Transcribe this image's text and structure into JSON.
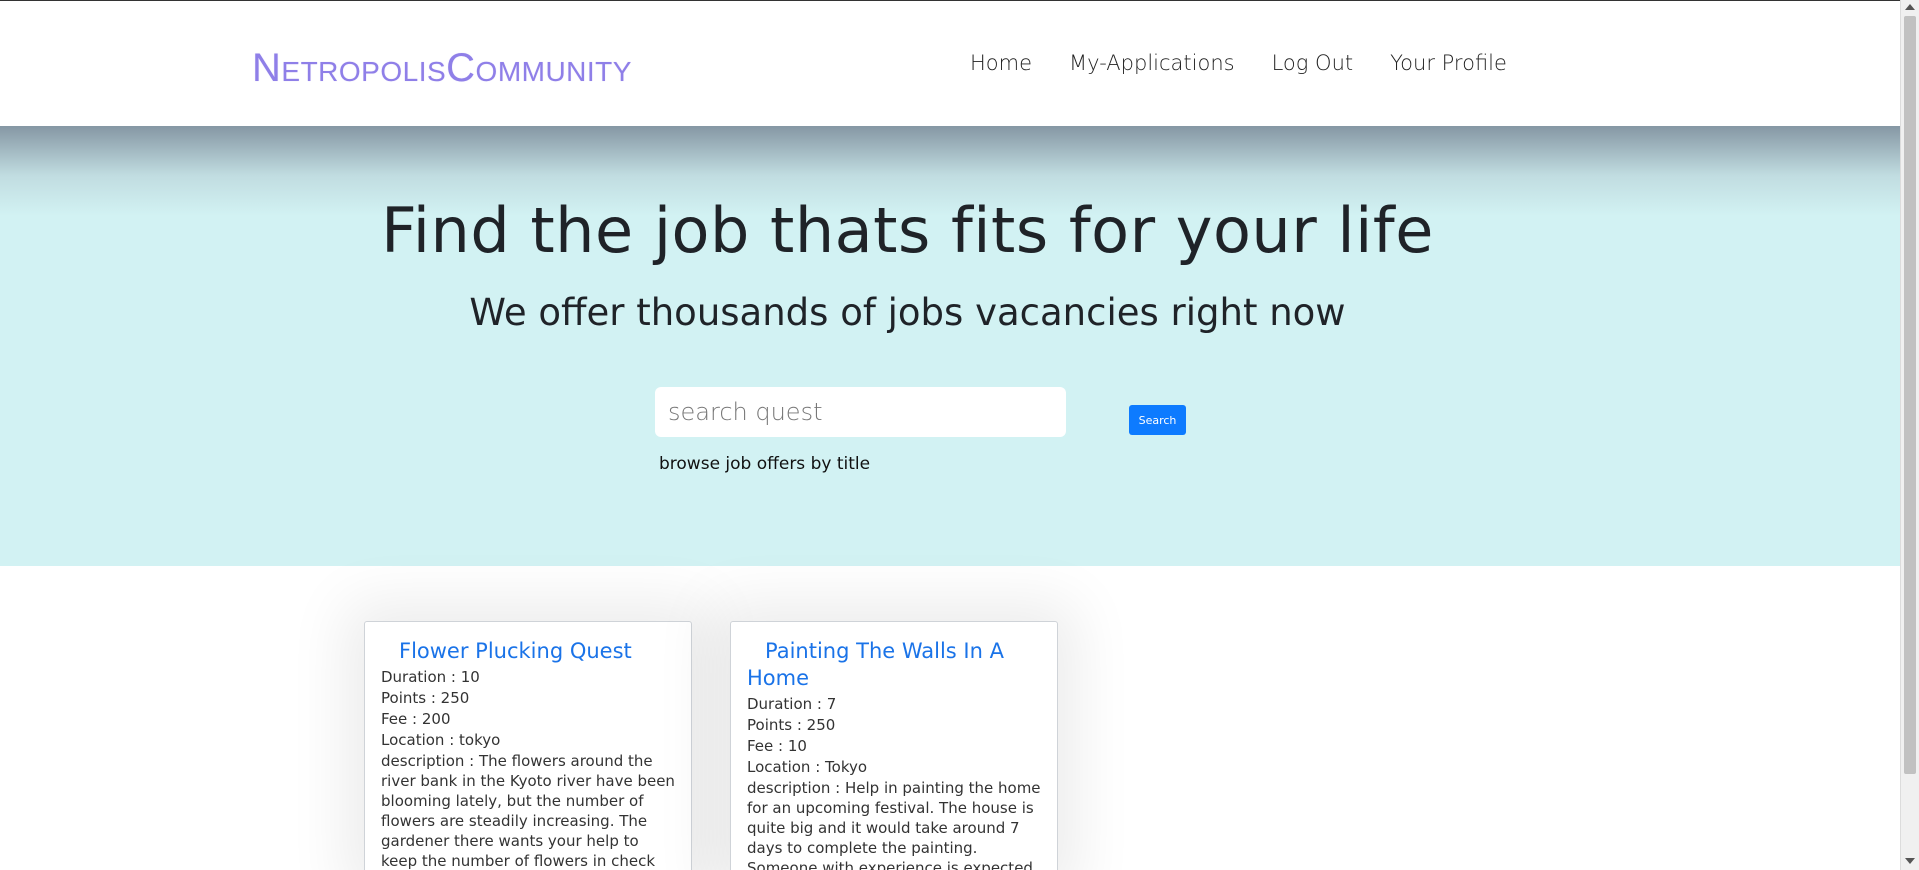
{
  "brand": "NetropolisCommunity",
  "nav": [
    "Home",
    "My-Applications",
    "Log Out",
    "Your Profile"
  ],
  "hero": {
    "title": "Find the job thats fits for your life",
    "subtitle": "We offer thousands of jobs vacancies right now",
    "search_placeholder": "search quest",
    "search_button": "Search",
    "hint": "browse job offers by title"
  },
  "cards": [
    {
      "title": "Flower Plucking Quest",
      "duration": "Duration : 10",
      "points": "Points : 250",
      "fee": "Fee : 200",
      "location": "Location : tokyo",
      "description": "description : The flowers around the river bank in the Kyoto river have been blooming lately, but the number of flowers are steadily increasing. The gardener there wants your help to keep the number of flowers in check"
    },
    {
      "title": "Painting The Walls In A Home",
      "duration": "Duration : 7",
      "points": "Points : 250",
      "fee": "Fee : 10",
      "location": "Location : Tokyo",
      "description": "description : Help in painting the home for an upcoming festival. The house is quite big and it would take around 7 days to complete the painting. Someone with experience is expected"
    }
  ],
  "colors": {
    "brand": "#8f7fe8",
    "hero_bg": "#d2f2f3",
    "link": "#1a73e8",
    "button": "#0d7bff"
  }
}
